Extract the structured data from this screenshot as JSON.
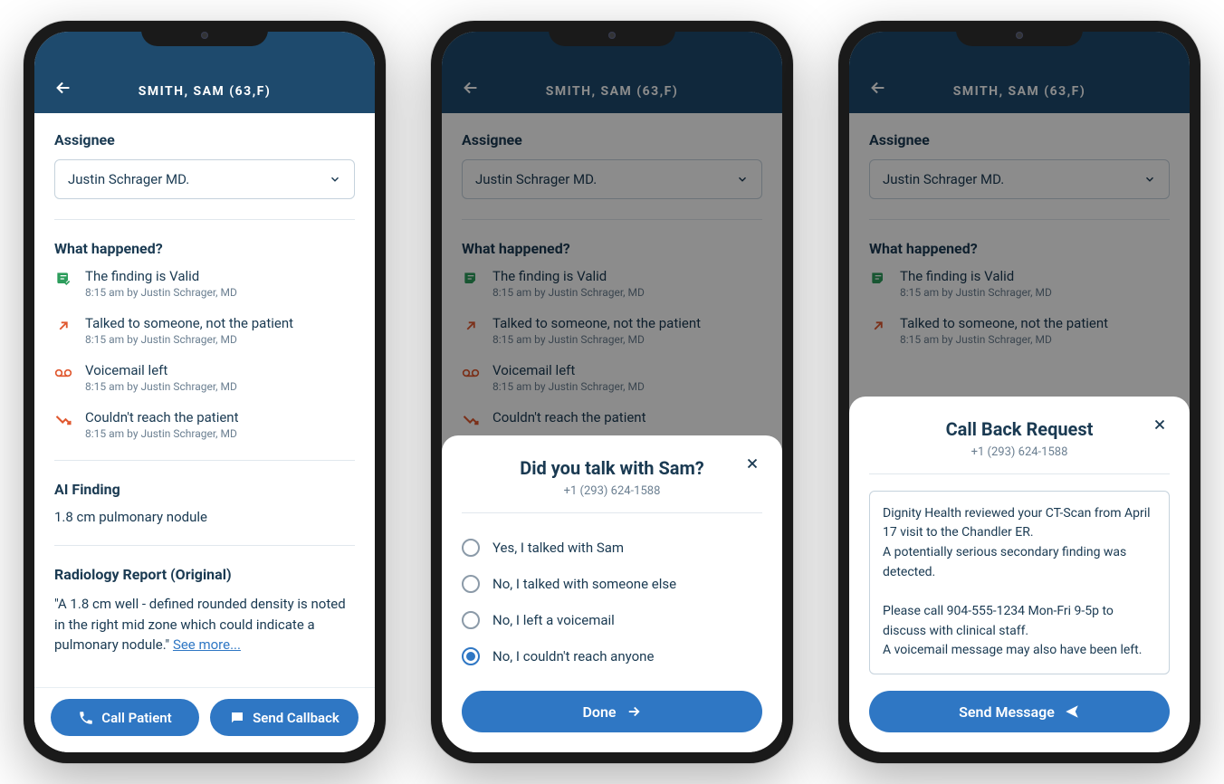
{
  "header": {
    "title": "SMITH, SAM (63,F)"
  },
  "assignee": {
    "label": "Assignee",
    "value": "Justin Schrager MD."
  },
  "whatHappened": {
    "label": "What happened?",
    "events": [
      {
        "title": "The finding is Valid",
        "meta": "8:15 am by Justin Schrager, MD"
      },
      {
        "title": "Talked to someone, not the patient",
        "meta": "8:15 am by Justin Schrager, MD"
      },
      {
        "title": "Voicemail left",
        "meta": "8:15 am by Justin Schrager, MD"
      },
      {
        "title": "Couldn't reach the patient",
        "meta": "8:15 am by Justin Schrager, MD"
      }
    ]
  },
  "aiFinding": {
    "label": "AI Finding",
    "text": "1.8 cm pulmonary nodule"
  },
  "report": {
    "label": "Radiology Report (Original)",
    "text": "\"A 1.8 cm well - defined rounded density is noted in the right mid zone which could indicate a pulmonary nodule.\" ",
    "seeMore": "See more..."
  },
  "bottomBar": {
    "callPatient": "Call Patient",
    "sendCallback": "Send Callback"
  },
  "sheet1": {
    "title": "Did you talk with Sam?",
    "phone": "+1 (293) 624-1588",
    "options": [
      "Yes, I talked with Sam",
      "No, I talked with someone else",
      "No, I left a voicemail",
      "No, I couldn't reach anyone"
    ],
    "selectedIndex": 3,
    "doneLabel": "Done"
  },
  "sheet2": {
    "title": "Call Back Request",
    "phone": "+1 (293) 624-1588",
    "message": "Dignity Health reviewed your CT-Scan from April 17 visit to the Chandler ER.\nA potentially serious secondary finding was detected.\n\nPlease call 904-555-1234 Mon-Fri 9-5p to discuss with clinical staff.\nA voicemail message may also have been left.",
    "sendLabel": "Send Message"
  },
  "colors": {
    "headerBg": "#1e4a6d",
    "primary": "#2f77c4",
    "text": "#1a3a52"
  }
}
